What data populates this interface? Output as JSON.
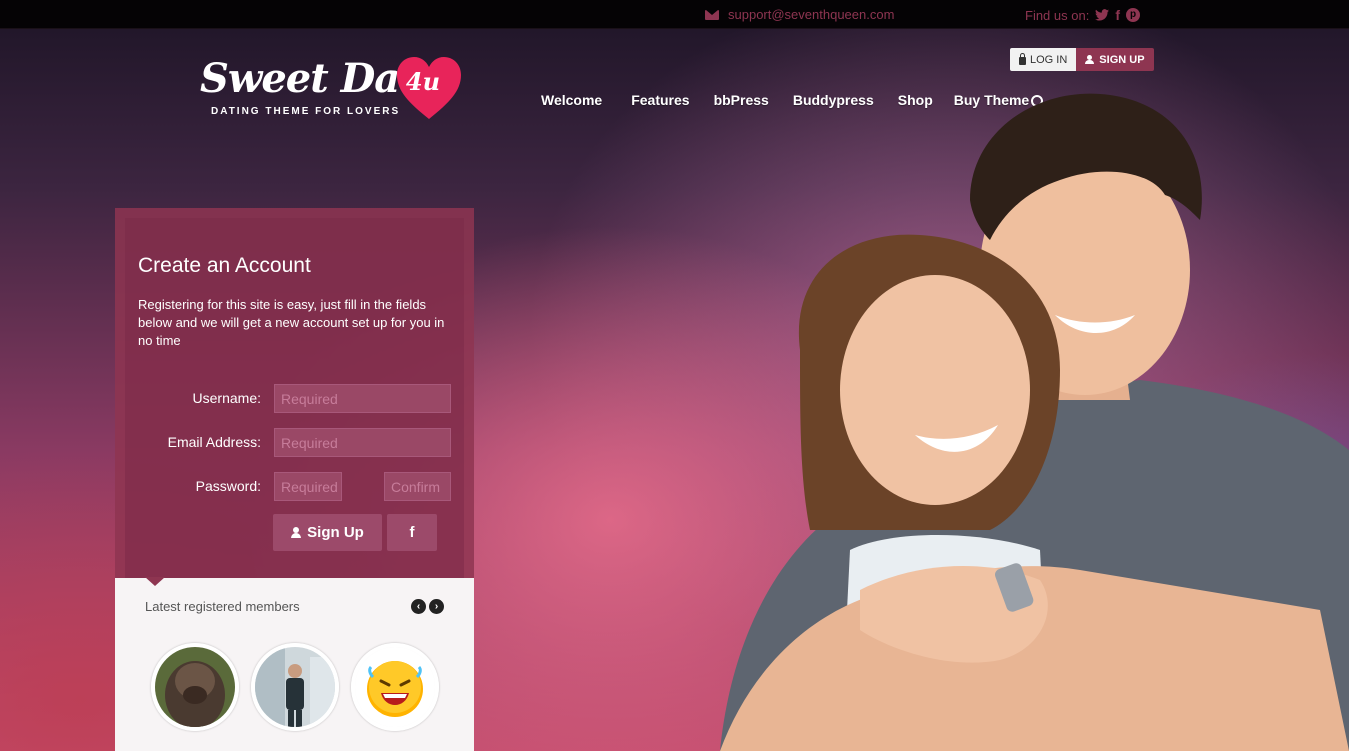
{
  "topbar": {
    "email": "support@seventhqueen.com",
    "find_us": "Find us on:",
    "social": {
      "twitter": "twitter-icon",
      "facebook": "f",
      "pinterest": "p"
    }
  },
  "logo": {
    "title": "Sweet Date",
    "badge": "4u",
    "tagline": "DATING THEME FOR LOVERS"
  },
  "auth": {
    "login": "LOG IN",
    "signup": "SIGN UP"
  },
  "nav": {
    "items": [
      "Welcome",
      "Features",
      "bbPress",
      "Buddypress",
      "Shop",
      "Buy Theme"
    ]
  },
  "register": {
    "title": "Create an Account",
    "intro": "Registering for this site is easy, just fill in the fields below and we will get a new account set up for you in no time",
    "username_label": "Username:",
    "username_placeholder": "Required",
    "email_label": "Email Address:",
    "email_placeholder": "Required",
    "password_label": "Password:",
    "password_placeholder": "Required",
    "confirm_placeholder": "Confirm",
    "signup_button": "Sign Up",
    "facebook_button": "f"
  },
  "members": {
    "title": "Latest registered members",
    "prev": "‹",
    "next": "›"
  },
  "colors": {
    "brand": "#8e3551",
    "field": "#9a4866",
    "placeholder": "#c77c9a"
  }
}
